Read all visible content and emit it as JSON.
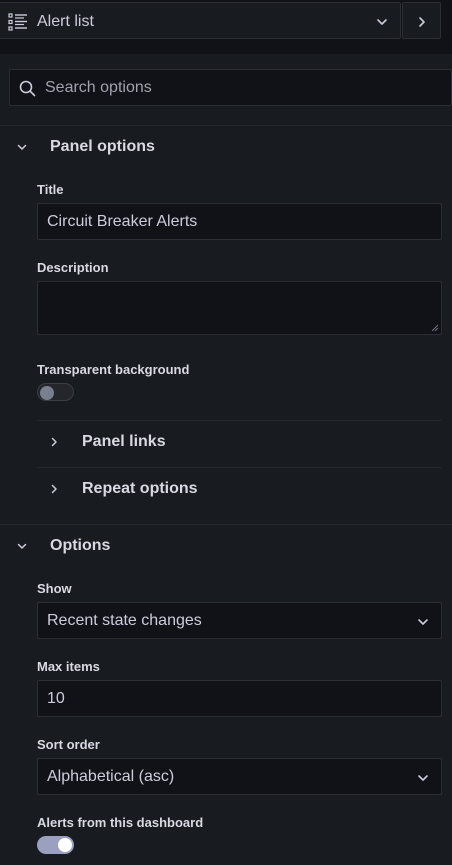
{
  "header": {
    "visualization_name": "Alert list",
    "viz_icon": "alert-list-icon",
    "dropdown_icon": "chevron-down-icon",
    "collapse_icon": "chevron-right-icon"
  },
  "search": {
    "placeholder": "Search options",
    "value": "",
    "icon": "search-icon"
  },
  "panel_options": {
    "label": "Panel options",
    "expanded": true,
    "title": {
      "label": "Title",
      "value": "Circuit Breaker Alerts"
    },
    "description": {
      "label": "Description",
      "value": ""
    },
    "transparent_background": {
      "label": "Transparent background",
      "enabled": false
    },
    "panel_links": {
      "label": "Panel links",
      "expanded": false
    },
    "repeat_options": {
      "label": "Repeat options",
      "expanded": false
    }
  },
  "options": {
    "label": "Options",
    "expanded": true,
    "show": {
      "label": "Show",
      "value": "Recent state changes"
    },
    "max_items": {
      "label": "Max items",
      "value": "10"
    },
    "sort_order": {
      "label": "Sort order",
      "value": "Alphabetical (asc)"
    },
    "alerts_from_this_dashboard": {
      "label": "Alerts from this dashboard",
      "enabled": true
    }
  },
  "colors": {
    "background": "#181b1f",
    "header_background": "#111217",
    "input_background": "#111217",
    "border": "#2c2e35",
    "text": "#ccccdc",
    "switch_on": "#9ba0c0"
  }
}
